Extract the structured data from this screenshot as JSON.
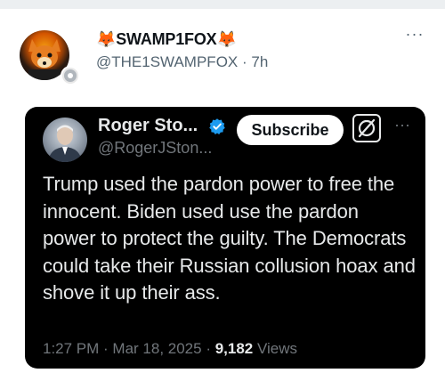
{
  "post": {
    "emoji_left": "🦊",
    "emoji_right": "🦊",
    "author_name": "SWAMP1FOX",
    "handle": "@THE1SWAMPFOX",
    "separator": " · ",
    "time": "7h",
    "more": "···"
  },
  "embed": {
    "author_name": "Roger Sto...",
    "handle": "@RogerJSton...",
    "subscribe_label": "Subscribe",
    "more": "···",
    "text": "Trump used the pardon power to free the innocent. Biden used use the pardon power to protect the guilty. The Democrats could take their Russian collusion hoax and shove it up their ass.",
    "time": "1:27 PM",
    "date_separator": " · ",
    "date": "Mar 18, 2025",
    "views_separator": " · ",
    "views_count": "9,182",
    "views_label": " Views"
  },
  "colors": {
    "verified": "#1d9bf0",
    "embed_background": "#000000",
    "secondary_text": "#71767b"
  },
  "icons": [
    "avatar",
    "verified-badge-icon",
    "grok-icon",
    "more-icon"
  ]
}
